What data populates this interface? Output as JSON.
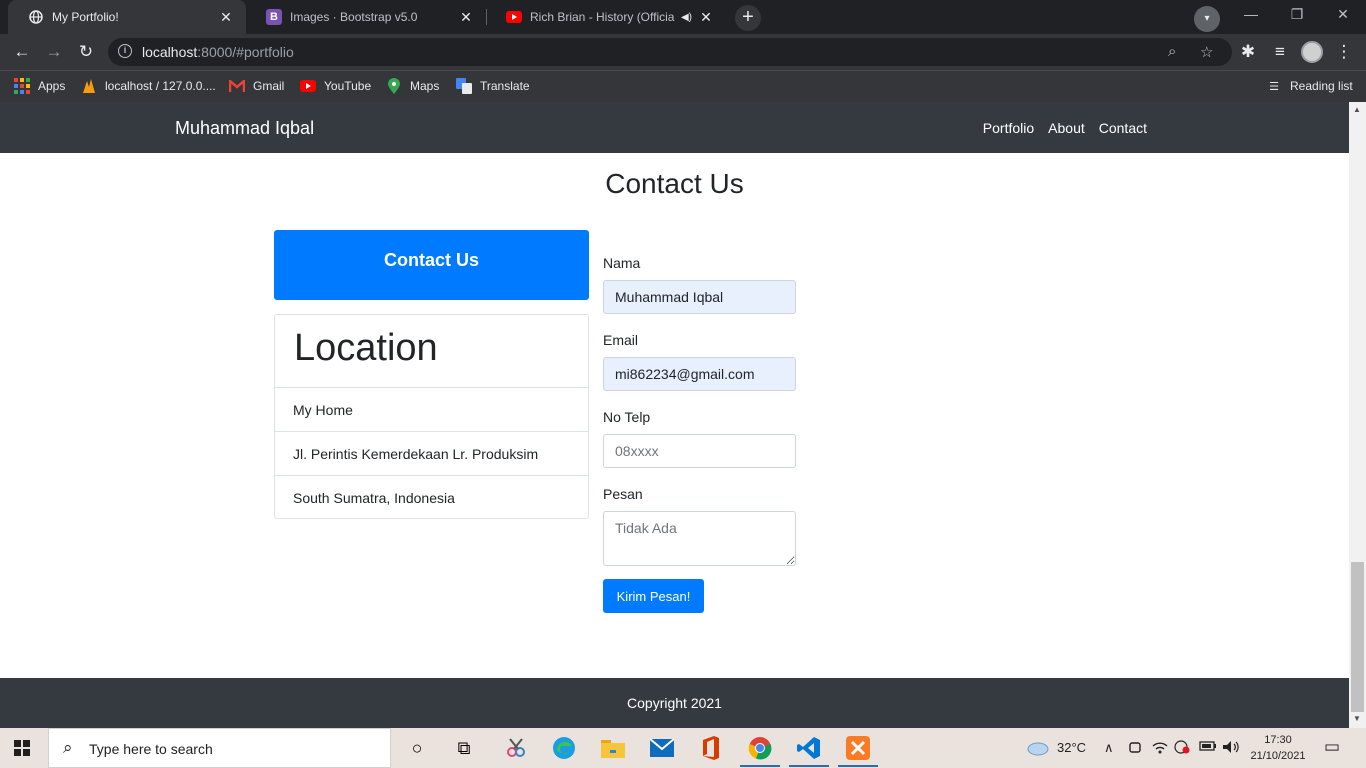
{
  "browser": {
    "tabs": [
      {
        "title": "My Portfolio!",
        "active": true
      },
      {
        "title": "Images · Bootstrap v5.0",
        "active": false
      },
      {
        "title": "Rich Brian - History (Official ",
        "active": false
      }
    ],
    "favicon_letters": {
      "bootstrap": "B"
    },
    "url_host": "localhost",
    "url_rest": ":8000/#portfolio",
    "bookmarks": [
      "Apps",
      "localhost / 127.0.0....",
      "Gmail",
      "YouTube",
      "Maps",
      "Translate"
    ],
    "reading_list": "Reading list",
    "glyphs": {
      "close": "✕",
      "plus": "+",
      "down": "▾",
      "minimize": "—",
      "restore": "❐",
      "back": "←",
      "forward": "→",
      "reload": "↻",
      "info": "i",
      "zoom": "⌕",
      "star": "☆",
      "extensions": "✱",
      "media": "≡",
      "menu": "⋮",
      "speaker": "◀)",
      "list": "☰"
    }
  },
  "site": {
    "brand": "Muhammad Iqbal",
    "nav": [
      "Portfolio",
      "About",
      "Contact"
    ],
    "section_title": "Contact Us",
    "jumbotron": "Contact Us",
    "location": {
      "title": "Location",
      "items": [
        "My Home",
        "Jl. Perintis Kemerdekaan Lr. Produksim",
        "South Sumatra, Indonesia"
      ]
    },
    "form": {
      "name_label": "Nama",
      "name_value": "Muhammad Iqbal",
      "email_label": "Email",
      "email_value": "mi862234@gmail.com",
      "phone_label": "No Telp",
      "phone_placeholder": "08xxxx",
      "message_label": "Pesan",
      "message_placeholder": "Tidak Ada",
      "submit": "Kirim Pesan!"
    },
    "footer": "Copyright 2021"
  },
  "taskbar": {
    "search_placeholder": "Type here to search",
    "temperature": "32°C",
    "time": "17:30",
    "date": "21/10/2021",
    "glyphs": {
      "search": "⌕",
      "cortana": "○",
      "taskview": "⧉",
      "chevron": "∧",
      "notification": "▭"
    }
  },
  "colors": {
    "primary": "#007bff",
    "dark": "#343a40",
    "chrome_bg": "#202124",
    "chrome_toolbar": "#35363a"
  }
}
